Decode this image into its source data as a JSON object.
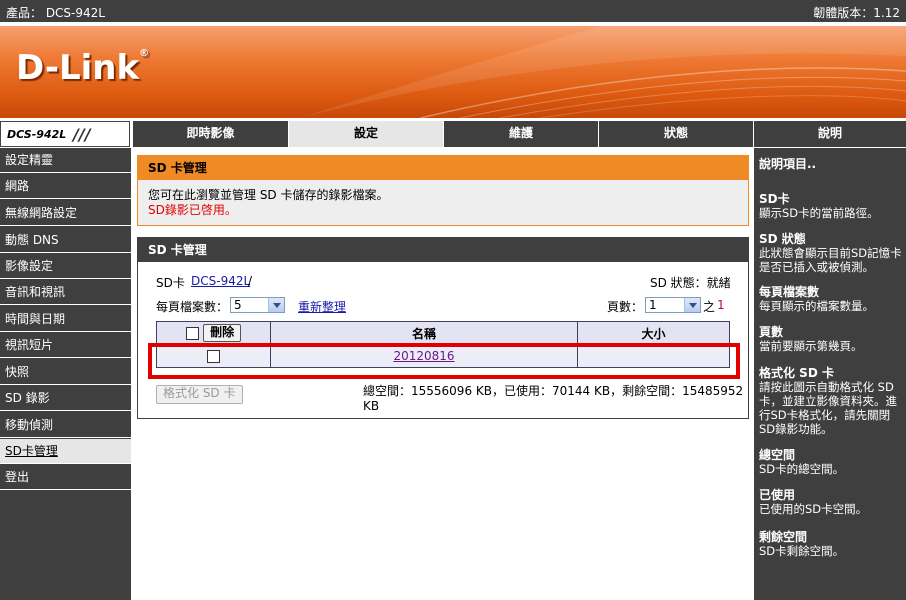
{
  "topbar": {
    "product": "產品： DCS-942L",
    "firmware": "韌體版本：1.12"
  },
  "brand": {
    "logo_text": "D-Link",
    "registered": "®"
  },
  "nav": {
    "model": "DCS-942L",
    "slashes": "///",
    "tabs": [
      "即時影像",
      "設定",
      "維護",
      "狀態",
      "說明"
    ]
  },
  "sidebar": {
    "items": [
      "設定精靈",
      "網路",
      "無線網路設定",
      "動態 DNS",
      "影像設定",
      "音訊和視訊",
      "時間與日期",
      "視訊短片",
      "快照",
      "SD 錄影",
      "移動偵測",
      "SD卡管理",
      "登出"
    ]
  },
  "panel1": {
    "title": "SD 卡管理",
    "desc": "您可在此瀏覽並管理 SD 卡儲存的錄影檔案。",
    "warning": "SD錄影已啓用。"
  },
  "panel2": {
    "title": "SD 卡管理",
    "sd_label": "SD卡",
    "sd_path_link": "DCS-942L",
    "sd_path_sep": "/",
    "sd_status": "SD 狀態：就緒",
    "per_page_label": "每頁檔案數：",
    "per_page_value": "5",
    "refresh_link": "重新整理",
    "page_label": "頁數：",
    "page_value": "1",
    "page_of": "之",
    "page_total": "1",
    "delete_button": "刪除",
    "col_name": "名稱",
    "col_size": "大小",
    "rows": [
      {
        "name": "20120816",
        "size": ""
      }
    ],
    "format_button": "格式化 SD 卡",
    "space_info": "總空間：15556096 KB，已使用：70144 KB，剩餘空間：15485952 KB"
  },
  "help": {
    "title": "說明項目..",
    "entries": [
      {
        "h": "SD卡",
        "d": "顯示SD卡的當前路徑。"
      },
      {
        "h": "SD 狀態",
        "d": "此狀態會顯示目前SD記憶卡是否已插入或被偵測。"
      },
      {
        "h": "每頁檔案數",
        "d": "每頁顯示的檔案數量。"
      },
      {
        "h": "頁數",
        "d": "當前要顯示第幾頁。"
      },
      {
        "h": "格式化 SD 卡",
        "d": "請按此圖示自動格式化 SD 卡，並建立影像資料夾。進行SD卡格式化，請先關閉SD錄影功能。"
      },
      {
        "h": "總空間",
        "d": "SD卡的總空間。"
      },
      {
        "h": "已使用",
        "d": "已使用的SD卡空間。"
      },
      {
        "h": "剩餘空間",
        "d": "SD卡剩餘空間。"
      }
    ]
  },
  "colors": {
    "accent_orange": "#f08a24",
    "dark_gray": "#3f3f3f",
    "highlight_red": "#e00000"
  }
}
